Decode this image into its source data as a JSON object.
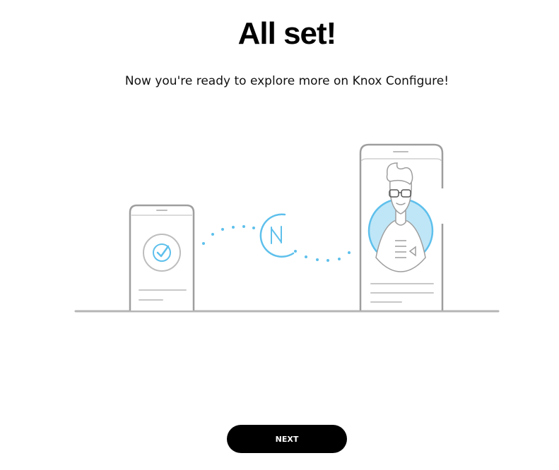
{
  "header": {
    "title": "All set!",
    "subtitle": "Now you're ready to explore more on Knox Configure!"
  },
  "illustration": {
    "line_color": "#9e9e9e",
    "accent_color": "#5ec0ec",
    "accent_fill": "#bfe6f7",
    "icons": [
      "phone-with-checkmark-icon",
      "nfc-icon",
      "phone-with-user-avatar-icon"
    ]
  },
  "footer": {
    "next_label": "NEXT"
  },
  "colors": {
    "background": "#ffffff",
    "button_bg": "#000000",
    "button_text": "#ffffff"
  }
}
